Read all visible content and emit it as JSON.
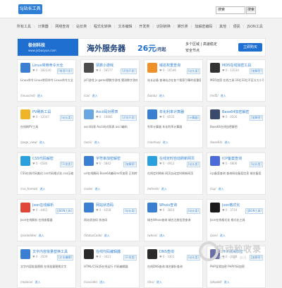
{
  "header": {
    "logo_text": "SJ站长工具",
    "search_placeholder": "搜索",
    "search_button": "搜索"
  },
  "nav": [
    "所有工具",
    "计算器",
    "网络查询",
    "站长类",
    "程式化转换",
    "文本编辑",
    "开发类",
    "识别转换",
    "娱乐类",
    "加解密编码",
    "其他",
    "便民",
    "JSON工具"
  ],
  "ad": {
    "brand": "极创科技",
    "brand_sub": "www.jicbaoyun.com",
    "headline": "海外服务器",
    "price": "26元",
    "price_unit": "/月起",
    "line1": "多个区域 | 高速稳定",
    "line2": "安全节点",
    "button": "立即购买"
  },
  "cards": [
    {
      "title": "Linux常用命令大全",
      "meta": "♥ 0 · 182330",
      "tag": "[常用开发]",
      "desc": "Linux命令 Linux常用命令 Linux命令大全",
      "foot": "/linuxcmd/",
      "link": "进入",
      "color": "#3b7fd3"
    },
    {
      "title": "猜数小游戏",
      "meta": "♥ 0 · 56577",
      "tag": "[识别开发]",
      "desc": "jsFl游戏 js game猜数字游戏 猜测数字游戏",
      "foot": "/cai/",
      "link": "进入",
      "color": "#4d4d4d"
    },
    {
      "title": "域名权重查询",
      "meta": "♥ 0 · 16546",
      "tag": "[站长类]",
      "desc": "站长必备 查询站点在各个搜索引擎的权重值",
      "foot": "/baidu/",
      "link": "进入",
      "color": "#f0902b"
    },
    {
      "title": "MD5在线加密工具",
      "meta": "♥ 0 · 13534",
      "tag": "[加解密]",
      "desc": "MD5加密 在线工具 16位32位不区分大小写",
      "foot": "/md5/",
      "link": "进入",
      "color": "#333333"
    },
    {
      "title": "PV刷新工具",
      "meta": "♥ 0 · 12047",
      "tag": "[站长类]",
      "desc": "在线刷PV工具",
      "foot": "/page_view/",
      "link": "进入",
      "color": "#f0b428"
    },
    {
      "title": "Ascii码对照表",
      "meta": "♥ 0 · 10881",
      "tag": "[识别开发]",
      "desc": "ascii码表 Ascii码对照表 ascii编码",
      "foot": "/ascii/",
      "link": "进入",
      "color": "#6aa7e0"
    },
    {
      "title": "年化利率计算器",
      "meta": "♥ 0 · 8535",
      "tag": "[计算器]",
      "desc": "利率计算器 年化利率计算器",
      "foot": "/nianhua/",
      "link": "进入",
      "color": "#3b7fd3"
    },
    {
      "title": "Base64加密解密",
      "meta": "♥ 0 · 8506",
      "tag": "[加解密]",
      "desc": "Base64在线加密解密",
      "foot": "/base64/",
      "link": "进入",
      "color": "#3b4a6b"
    },
    {
      "title": "CSS代码解密",
      "meta": "♥ 0 · 6580",
      "tag": "[开发类]",
      "desc": "CSS在线代码美化 css代码格式化 css压缩",
      "foot": "/css_format/",
      "link": "进入",
      "color": "#2aa0dc"
    },
    {
      "title": "字符串加密解密",
      "meta": "♥ 0 · 5842",
      "tag": "[加解密]",
      "desc": "url在线解码 Base64编码md5加密 正则转义",
      "foot": "/code/",
      "link": "进入",
      "color": "#3b7fd3"
    },
    {
      "title": "在线定时自动刷新网页",
      "meta": "♥ 0 · 4912",
      "tag": "[站长类]",
      "desc": "在线定时刷新 网页自动定时刷新网页",
      "foot": "/refresh/",
      "link": "进入",
      "color": "#2aa0dc"
    },
    {
      "title": "ICP备案查询",
      "meta": "♥ 0 · 4806",
      "tag": "[站长类]",
      "desc": "icp备案查询 查询网站备案信息 域名备案",
      "foot": "/icp/",
      "link": "进入",
      "color": "#4d6bd6"
    },
    {
      "title": "Json在线解析",
      "meta": "♥ 0 · 4461",
      "tag": "[JSON工具]",
      "desc": "Json在线解析 在线查看器",
      "foot": "/jsonbdate/",
      "link": "进入",
      "color": "#e0463a"
    },
    {
      "title": "网站状态码",
      "meta": "♥ 0 · 4358",
      "tag": "[站长类]",
      "desc": "网站状态码 状态码",
      "foot": "/StatusCode/",
      "link": "进入",
      "color": "#3b7fd3"
    },
    {
      "title": "Whois查询",
      "meta": "♥ 0 · 3810",
      "tag": "[站长类]",
      "desc": "域名Whois查询 域名注册信息查询",
      "foot": "/whois/",
      "link": "进入",
      "color": "#3b7fd3"
    },
    {
      "title": "Json格式化",
      "meta": "♥ 0 · 3719",
      "tag": "[JSON工具]",
      "desc": "Json在线格式化 格式化工具",
      "foot": "/json/",
      "link": "进入",
      "color": "#1a1a1a"
    },
    {
      "title": "文字内容批量替换工具",
      "meta": "♥ 0 · 3509",
      "tag": "[文本编辑]",
      "desc": "文字内容批量替换 在线批量替换文字",
      "foot": "/replace/",
      "link": "进入",
      "color": "#3b7fd3"
    },
    {
      "title": "在线代码编辑器",
      "meta": "♥ 0 · 3421",
      "tag": "[开发类]",
      "desc": "HTML/CSS/JS在线运行 代码编辑器",
      "foot": "/runcode/",
      "link": "进入",
      "color": "#2a2a2a"
    },
    {
      "title": "DNS查询",
      "meta": "♥ 0 · 3301",
      "tag": "[站长类]",
      "desc": "在线DNS查询 域名解析查询",
      "foot": "/dns/",
      "link": "进入",
      "color": "#2a2a2a"
    },
    {
      "title": "PHP混淆加密",
      "meta": "♥ 0 · 3188",
      "tag": "[加解密]",
      "desc": "PHP混淆加密 PHP代码加密",
      "foot": "/phpobf/",
      "link": "进入",
      "color": "#6b6fa8"
    }
  ],
  "watermark": {
    "text": "自动秒收录",
    "sub": "技术 · 干货 · 资讯 · 工具"
  }
}
